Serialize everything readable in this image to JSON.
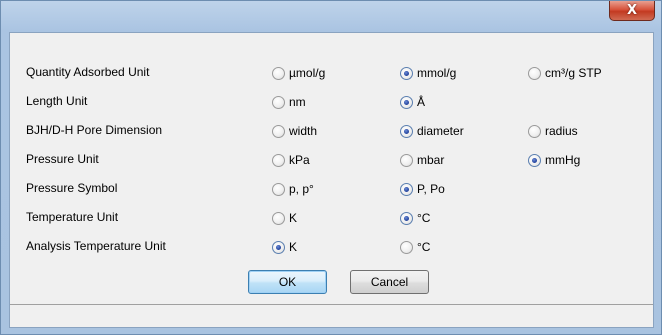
{
  "window": {
    "close_glyph": "X"
  },
  "rows": [
    {
      "label": "Quantity Adsorbed Unit",
      "options": [
        {
          "label": "µmol/g",
          "checked": false
        },
        {
          "label": "mmol/g",
          "checked": true
        },
        {
          "label": "cm³/g STP",
          "checked": false
        }
      ]
    },
    {
      "label": "Length Unit",
      "options": [
        {
          "label": "nm",
          "checked": false
        },
        {
          "label": "Å",
          "checked": true
        }
      ]
    },
    {
      "label": "BJH/D-H Pore Dimension",
      "options": [
        {
          "label": "width",
          "checked": false
        },
        {
          "label": "diameter",
          "checked": true
        },
        {
          "label": "radius",
          "checked": false
        }
      ]
    },
    {
      "label": "Pressure Unit",
      "options": [
        {
          "label": "kPa",
          "checked": false
        },
        {
          "label": "mbar",
          "checked": false
        },
        {
          "label": "mmHg",
          "checked": true
        }
      ]
    },
    {
      "label": "Pressure Symbol",
      "options": [
        {
          "label": "p, p°",
          "checked": false
        },
        {
          "label": "P, Po",
          "checked": true
        }
      ]
    },
    {
      "label": "Temperature Unit",
      "options": [
        {
          "label": "K",
          "checked": false
        },
        {
          "label": "°C",
          "checked": true
        }
      ]
    },
    {
      "label": "Analysis Temperature Unit",
      "options": [
        {
          "label": "K",
          "checked": true
        },
        {
          "label": "°C",
          "checked": false
        }
      ]
    }
  ],
  "buttons": {
    "ok_label": "OK",
    "cancel_label": "Cancel"
  }
}
